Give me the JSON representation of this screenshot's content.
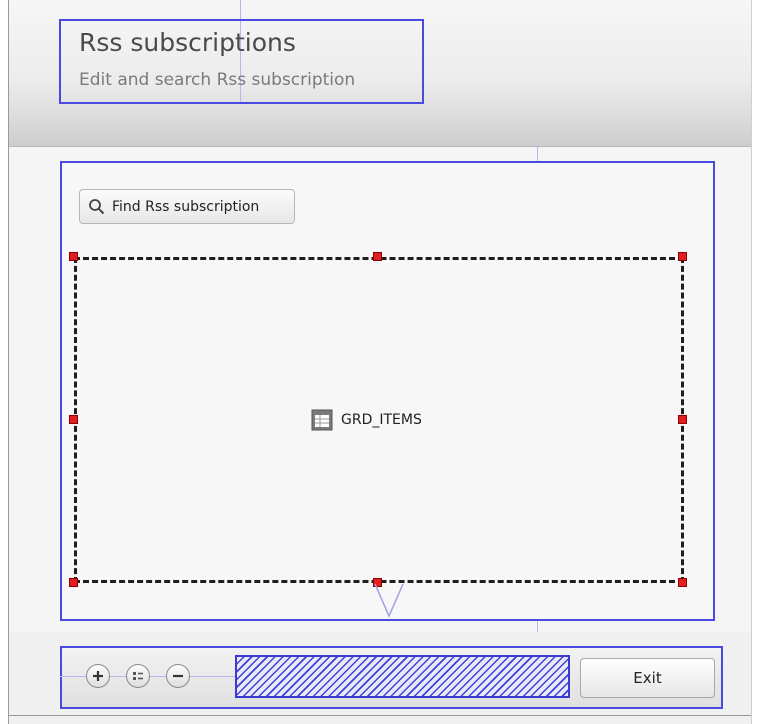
{
  "header": {
    "title": "Rss subscriptions",
    "subtitle": "Edit and search Rss subscription"
  },
  "toolbar": {
    "find_label": "Find Rss subscription",
    "find_icon": "search-icon"
  },
  "grid": {
    "label": "GRD_ITEMS",
    "icon": "grid-icon"
  },
  "footer": {
    "add_icon": "plus-icon",
    "details_icon": "details-icon",
    "remove_icon": "minus-icon",
    "exit_label": "Exit"
  },
  "colors": {
    "selection_border": "#4a4ae0",
    "handle": "#e02020",
    "guide": "#b8b8f0"
  }
}
